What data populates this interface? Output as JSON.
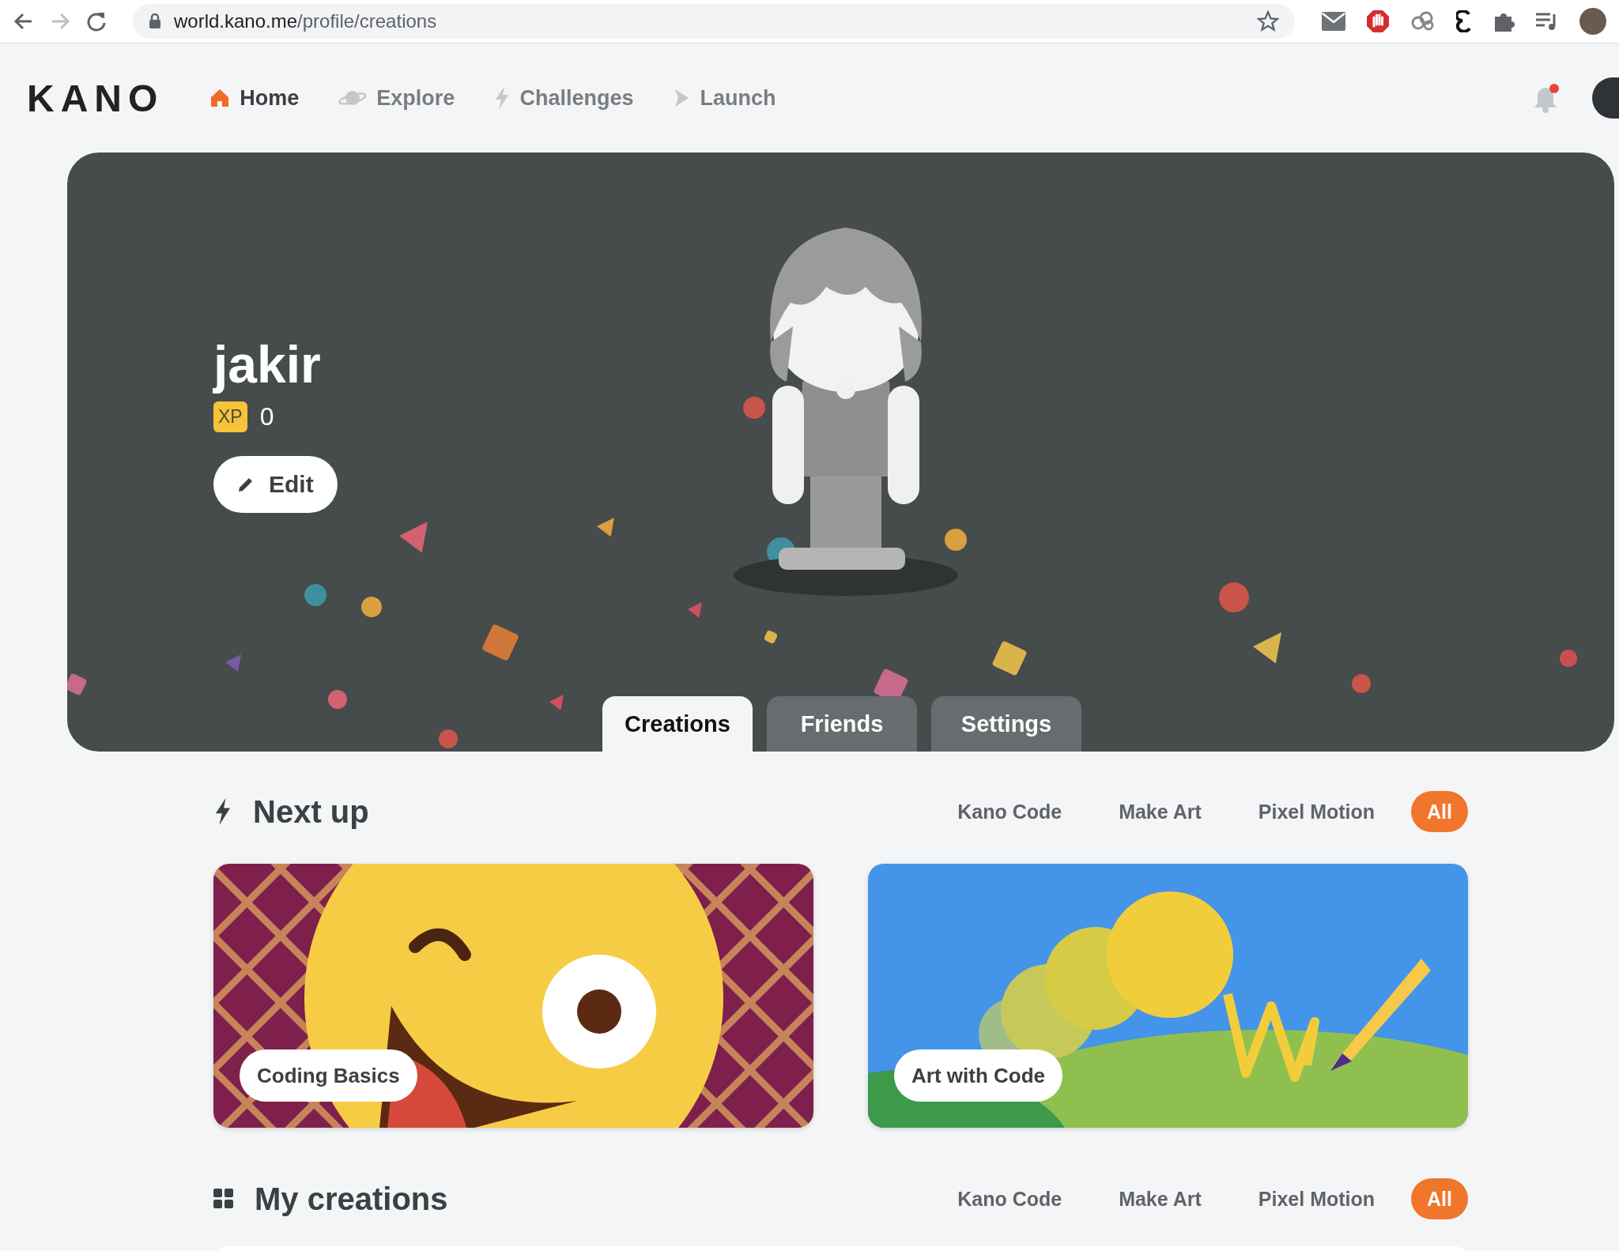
{
  "browser": {
    "url_host": "world.kano.me",
    "url_path": "/profile/creations"
  },
  "nav": {
    "logo": "KANO",
    "items": [
      {
        "label": "Home",
        "kind": "home",
        "selected": true
      },
      {
        "label": "Explore",
        "kind": "planet",
        "selected": false
      },
      {
        "label": "Challenges",
        "kind": "bolt",
        "selected": false
      },
      {
        "label": "Launch",
        "kind": "play",
        "selected": false
      }
    ],
    "notifications_unread": true
  },
  "profile": {
    "name": "jakir",
    "xp_badge": "XP",
    "xp": "0",
    "edit_button": "Edit"
  },
  "tabs": [
    {
      "label": "Creations",
      "selected": true
    },
    {
      "label": "Friends",
      "selected": false
    },
    {
      "label": "Settings",
      "selected": false
    }
  ],
  "sections": [
    {
      "title": "Next up",
      "kind": "bolt",
      "filters": [
        {
          "label": "Kano Code",
          "selected": false
        },
        {
          "label": "Make Art",
          "selected": false
        },
        {
          "label": "Pixel Motion",
          "selected": false
        },
        {
          "label": "All",
          "selected": true
        }
      ],
      "cards": [
        {
          "label": "Coding Basics",
          "kind": "face"
        },
        {
          "label": "Art with Code",
          "kind": "landscape"
        }
      ]
    },
    {
      "title": "My creations",
      "kind": "grid",
      "filters": [
        {
          "label": "Kano Code",
          "selected": false
        },
        {
          "label": "Make Art",
          "selected": false
        },
        {
          "label": "Pixel Motion",
          "selected": false
        },
        {
          "label": "All",
          "selected": true
        }
      ]
    }
  ]
}
